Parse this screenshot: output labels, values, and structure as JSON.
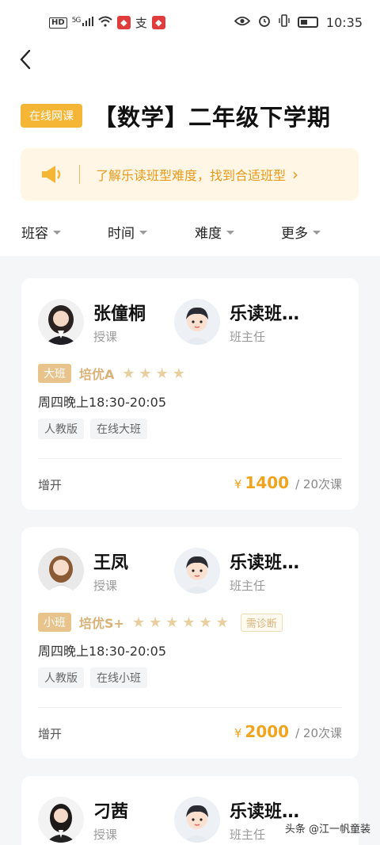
{
  "status_bar": {
    "hd": "HD",
    "network": "5G",
    "time": "10:35"
  },
  "header": {
    "back_icon": "chevron-left-icon",
    "badge": "在线网课",
    "title": "【数学】二年级下学期"
  },
  "notice": {
    "icon": "megaphone-icon",
    "text": "了解乐读班型难度，找到合适班型",
    "arrow": "›"
  },
  "filters": [
    {
      "label": "班容"
    },
    {
      "label": "时间"
    },
    {
      "label": "难度"
    },
    {
      "label": "更多"
    }
  ],
  "courses": [
    {
      "teacher_name": "张僮桐",
      "teacher_role": "授课",
      "head_name": "乐读班…",
      "head_role": "班主任",
      "size": "大班",
      "level": "培优A",
      "stars": "★★★★",
      "schedule": "周四晚上18:30-20:05",
      "tags": [
        "人教版",
        "在线大班"
      ],
      "status": "增开",
      "currency": "¥",
      "price": "1400",
      "lessons": "/ 20次课"
    },
    {
      "teacher_name": "王凤",
      "teacher_role": "授课",
      "head_name": "乐读班…",
      "head_role": "班主任",
      "size": "小班",
      "level": "培优S+",
      "stars": "★★★★★★",
      "diag": "需诊断",
      "schedule": "周四晚上18:30-20:05",
      "tags": [
        "人教版",
        "在线小班"
      ],
      "status": "增开",
      "currency": "¥",
      "price": "2000",
      "lessons": "/ 20次课"
    },
    {
      "teacher_name": "刁茜",
      "teacher_role": "授课",
      "head_name": "乐读班…",
      "head_role": "班主任"
    }
  ],
  "watermark": "头条 @江一帆童装",
  "colors": {
    "accent": "#f0a41e",
    "badge": "#f5b535",
    "gold": "#d9b27a"
  }
}
